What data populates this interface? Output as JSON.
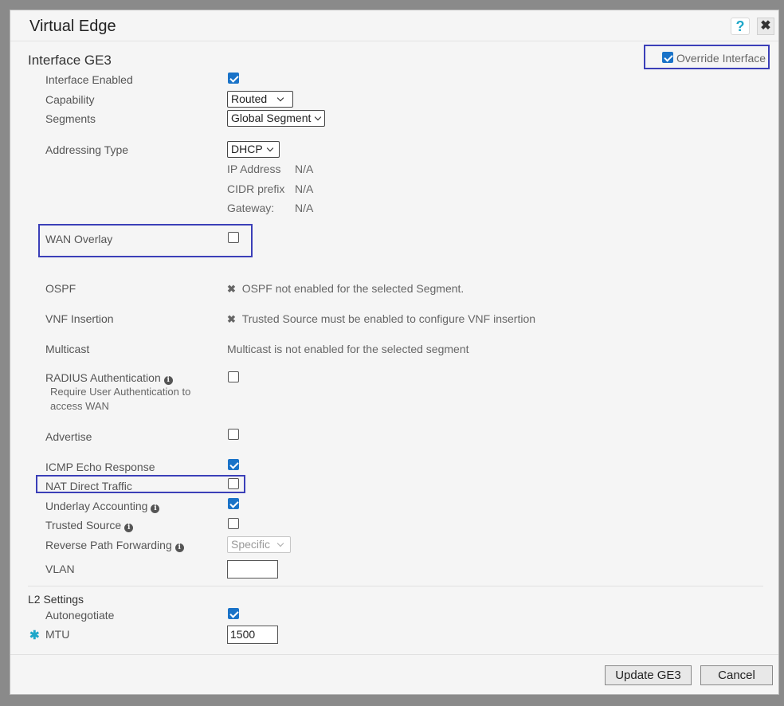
{
  "dialog": {
    "title": "Virtual Edge",
    "help_icon": "?",
    "close_icon": "✖"
  },
  "interface": {
    "title": "Interface GE3",
    "override_label": "Override Interface",
    "override_checked": true
  },
  "fields": {
    "interface_enabled": {
      "label": "Interface Enabled",
      "checked": true
    },
    "capability": {
      "label": "Capability",
      "value": "Routed"
    },
    "segments": {
      "label": "Segments",
      "value": "Global Segment"
    },
    "addressing_type": {
      "label": "Addressing Type",
      "value": "DHCP"
    },
    "ip_address": {
      "label": "IP Address",
      "value": "N/A"
    },
    "cidr_prefix": {
      "label": "CIDR prefix",
      "value": "N/A"
    },
    "gateway": {
      "label": "Gateway:",
      "value": "N/A"
    },
    "wan_overlay": {
      "label": "WAN Overlay",
      "checked": false
    },
    "ospf": {
      "label": "OSPF",
      "message": "OSPF not enabled for the selected Segment."
    },
    "vnf_insertion": {
      "label": "VNF Insertion",
      "message": "Trusted Source must be enabled to configure VNF insertion"
    },
    "multicast": {
      "label": "Multicast",
      "message": "Multicast is not enabled for the selected segment"
    },
    "radius": {
      "label": "RADIUS Authentication",
      "sub_line1": "Require User Authentication to",
      "sub_line2": "access WAN",
      "checked": false
    },
    "advertise": {
      "label": "Advertise",
      "checked": false
    },
    "icmp": {
      "label": "ICMP Echo Response",
      "checked": true
    },
    "nat_direct": {
      "label": "NAT Direct Traffic",
      "checked": false
    },
    "underlay_accounting": {
      "label": "Underlay Accounting",
      "checked": true
    },
    "trusted_source": {
      "label": "Trusted Source",
      "checked": false
    },
    "rpf": {
      "label": "Reverse Path Forwarding",
      "value": "Specific"
    },
    "vlan": {
      "label": "VLAN",
      "value": ""
    }
  },
  "l2": {
    "title": "L2 Settings",
    "autonegotiate": {
      "label": "Autonegotiate",
      "checked": true
    },
    "mtu": {
      "label": "MTU",
      "value": "1500",
      "required_mark": "✱"
    }
  },
  "footer": {
    "update_label": "Update GE3",
    "cancel_label": "Cancel"
  },
  "colors": {
    "accent": "#1a73c8",
    "highlight": "#3b3fb8",
    "help": "#1ea7c9"
  }
}
